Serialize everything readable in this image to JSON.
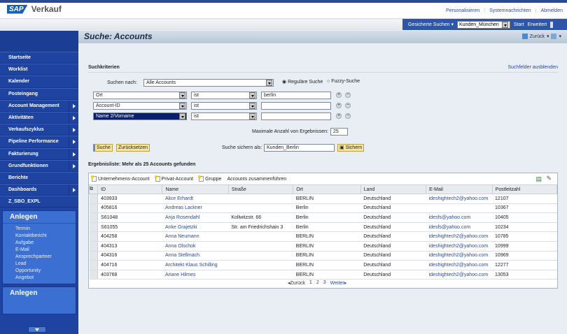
{
  "header": {
    "logo": "SAP",
    "app": "Verkauf",
    "links": [
      "Personalisieren",
      "Systemnachrichten",
      "Abmelden"
    ]
  },
  "searchpanel": {
    "saved_label": "Gesicherte Suchen ▾",
    "saved_value": "Kunden_München",
    "start": "Start",
    "erweitert": "Erweitert"
  },
  "page": {
    "title": "Suche: Accounts",
    "back": "Zurück"
  },
  "sidebar": {
    "items": [
      {
        "label": "Startseite",
        "arrow": false
      },
      {
        "label": "Worklist",
        "arrow": false
      },
      {
        "label": "Kalender",
        "arrow": false
      },
      {
        "label": "Posteingang",
        "arrow": false
      },
      {
        "label": "Account Management",
        "arrow": true
      },
      {
        "label": "Aktivitäten",
        "arrow": true
      },
      {
        "label": "Verkaufszyklus",
        "arrow": true
      },
      {
        "label": "Pipeline Performance",
        "arrow": true
      },
      {
        "label": "Fakturierung",
        "arrow": true
      },
      {
        "label": "Grundfunktionen",
        "arrow": true
      },
      {
        "label": "Berichte",
        "arrow": false
      },
      {
        "label": "Dashboards",
        "arrow": true
      },
      {
        "label": "Z_SBO_EXPL",
        "arrow": false
      }
    ],
    "anlegen": {
      "title": "Anlegen",
      "items": [
        "Termin",
        "Kontaktbericht",
        "Aufgabe",
        "E-Mail",
        "Ansprechpartner",
        "Lead",
        "Opportunity",
        "Angebot"
      ]
    },
    "anlegen2": {
      "title": "Anlegen"
    }
  },
  "criteria": {
    "title": "Suchkriterien",
    "hide": "Suchfelder ausblenden",
    "search_for_label": "Suchen nach:",
    "search_for": "Alle Accounts",
    "regular": "Reguläre Suche",
    "fuzzy": "Fuzzy-Suche",
    "rows": [
      {
        "field": "Ort",
        "op": "ist",
        "value": "berlin"
      },
      {
        "field": "Account-ID",
        "op": "ist",
        "value": ""
      },
      {
        "field": "Name 2/Vorname",
        "op": "ist",
        "value": ""
      }
    ],
    "max_label": "Maximale Anzahl von Ergebnissen:",
    "max": "25",
    "search_btn": "Suche",
    "reset_btn": "Zurücksetzen",
    "save_label": "Suche sichern als:",
    "save_value": "Kunden_Berlin",
    "save_btn": "Sichern"
  },
  "results": {
    "title": "Ergebnisliste: Mehr als 25 Accounts gefunden",
    "tools": [
      "Unternehmens-Account",
      "Privat-Account",
      "Gruppe",
      "Accounts zusammenführen"
    ],
    "columns": [
      "ID",
      "Name",
      "Straße",
      "Ort",
      "Land",
      "E-Mail",
      "Postleitzahl"
    ],
    "rows": [
      [
        "403933",
        "Alice Erhardt",
        "",
        "BERLIN",
        "Deutschland",
        "ideshightech2@yahoo.com",
        "12107"
      ],
      [
        "405816",
        "Andreas Lackner",
        "",
        "Berlin",
        "Deutschland",
        "",
        "10367"
      ],
      [
        "S61048",
        "Anja Rosendahl",
        "Kollwitzstr. 66",
        "Berlin",
        "Deutschland",
        "idesfs@yahoo.com",
        "10405"
      ],
      [
        "S61055",
        "Anke Grajetzki",
        "Str. am Friedrichshain 3",
        "Berlin",
        "Deutschland",
        "idesfs@yahoo.com",
        "10234"
      ],
      [
        "404258",
        "Anna Neumann",
        "",
        "BERLIN",
        "Deutschland",
        "ideshightech2@yahoo.com",
        "10785"
      ],
      [
        "404313",
        "Anna Olschok",
        "",
        "BERLIN",
        "Deutschland",
        "ideshightech2@yahoo.com",
        "10999"
      ],
      [
        "404316",
        "Anna Stellmach",
        "",
        "BERLIN",
        "Deutschland",
        "ideshightech2@yahoo.com",
        "10969"
      ],
      [
        "404716",
        "Architekt Klaus Schilling",
        "",
        "BERLIN",
        "Deutschland",
        "ideshightech2@yahoo.com",
        "12277"
      ],
      [
        "403768",
        "Ariane Hilmes",
        "",
        "BERLIN",
        "Deutschland",
        "ideshightech2@yahoo.com",
        "13053"
      ]
    ],
    "pager": {
      "prev": "◂Zurück",
      "pages": [
        "1",
        "2",
        "3"
      ],
      "next": "Weiter▸"
    }
  }
}
